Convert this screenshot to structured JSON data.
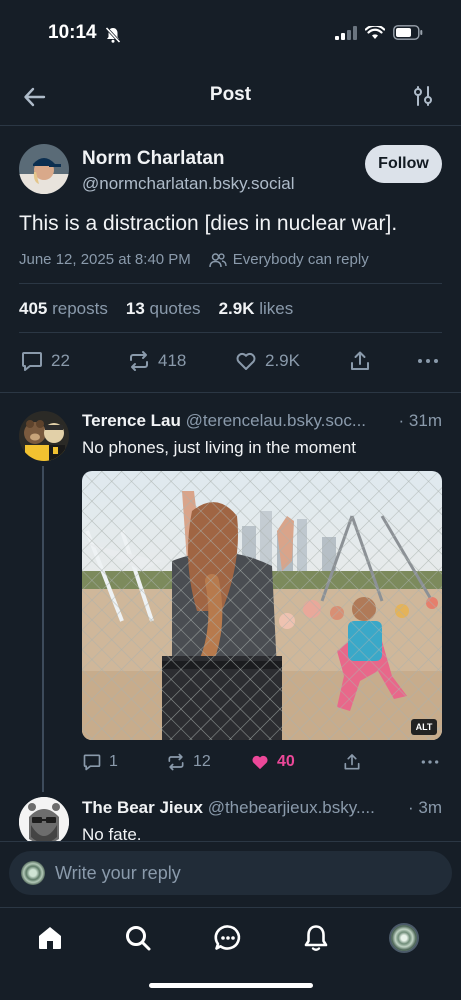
{
  "status_bar": {
    "time": "10:14"
  },
  "header": {
    "title": "Post"
  },
  "post": {
    "author_name": "Norm Charlatan",
    "author_handle": "@normcharlatan.bsky.social",
    "follow_label": "Follow",
    "text": "This is a distraction [dies in nuclear war].",
    "timestamp": "June 12, 2025 at 8:40 PM",
    "reply_setting": "Everybody can reply",
    "stats": {
      "reposts_count": "405",
      "reposts_label": "reposts",
      "quotes_count": "13",
      "quotes_label": "quotes",
      "likes_count": "2.9K",
      "likes_label": "likes"
    },
    "actions": {
      "replies": "22",
      "reposts": "418",
      "likes": "2.9K"
    }
  },
  "replies": [
    {
      "author_name": "Terence Lau",
      "author_handle": "@terencelau.bsky.soc...",
      "time": "· 31m",
      "text": "No phones, just living in the moment",
      "image_alt_badge": "ALT",
      "actions": {
        "replies": "1",
        "reposts": "12",
        "likes": "40"
      }
    },
    {
      "author_name": "The Bear Jieux",
      "author_handle": "@thebearjieux.bsky....",
      "time": "· 3m",
      "text": "No fate."
    }
  ],
  "composer": {
    "placeholder": "Write your reply"
  },
  "tabs": [
    "home-icon",
    "search-icon",
    "chat-icon",
    "bell-icon",
    "profile-avatar"
  ],
  "colors": {
    "background": "#161e27",
    "like_pink": "#ec4899",
    "muted": "#8a9aab",
    "follow_bg": "#dce2ea"
  }
}
